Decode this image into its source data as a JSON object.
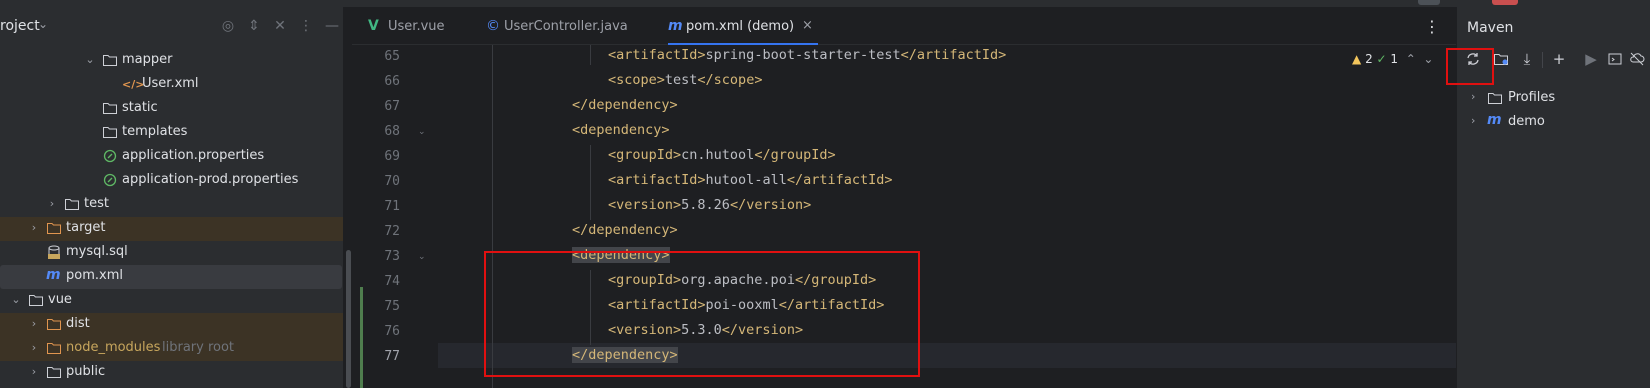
{
  "project_panel": {
    "title": "roject",
    "tree": [
      {
        "label": "mapper",
        "type": "folder",
        "expanded": true
      },
      {
        "label": "User.xml",
        "type": "xml"
      },
      {
        "label": "static",
        "type": "folder"
      },
      {
        "label": "templates",
        "type": "folder"
      },
      {
        "label": "application.properties",
        "type": "properties"
      },
      {
        "label": "application-prod.properties",
        "type": "properties"
      },
      {
        "label": "test",
        "type": "folder",
        "collapsed": true
      },
      {
        "label": "target",
        "type": "folder",
        "collapsed": true,
        "highlight": "excluded"
      },
      {
        "label": "mysql.sql",
        "type": "sql"
      },
      {
        "label": "pom.xml",
        "type": "maven",
        "selected": true
      },
      {
        "label": "vue",
        "type": "folder",
        "expanded": true
      },
      {
        "label": "dist",
        "type": "folder",
        "collapsed": true,
        "highlight": "excluded"
      },
      {
        "label": "node_modules",
        "hint": "library root",
        "type": "folder",
        "collapsed": true,
        "highlight": "excluded"
      },
      {
        "label": "public",
        "type": "folder",
        "collapsed": true
      }
    ]
  },
  "editor": {
    "tabs": [
      {
        "label": "User.vue",
        "icon": "vue-icon"
      },
      {
        "label": "UserController.java",
        "icon": "class-icon"
      },
      {
        "label": "pom.xml (demo)",
        "icon": "maven-icon",
        "active": true
      }
    ],
    "lines": [
      {
        "n": "65",
        "code": "<artifactId>spring-boot-starter-test</artifactId>"
      },
      {
        "n": "66",
        "code": "<scope>test</scope>"
      },
      {
        "n": "67",
        "code": "</dependency>"
      },
      {
        "n": "68",
        "code": "<dependency>"
      },
      {
        "n": "69",
        "code": "<groupId>cn.hutool</groupId>"
      },
      {
        "n": "70",
        "code": "<artifactId>hutool-all</artifactId>"
      },
      {
        "n": "71",
        "code": "<version>5.8.26</version>"
      },
      {
        "n": "72",
        "code": "</dependency>"
      },
      {
        "n": "73",
        "code": "<dependency>"
      },
      {
        "n": "74",
        "code": "<groupId>org.apache.poi</groupId>"
      },
      {
        "n": "75",
        "code": "<artifactId>poi-ooxml</artifactId>"
      },
      {
        "n": "76",
        "code": "<version>5.3.0</version>"
      },
      {
        "n": "77",
        "code": "</dependency>"
      }
    ],
    "inspection": {
      "warnings": "2",
      "ok": "1"
    }
  },
  "maven": {
    "title": "Maven",
    "toolbar": [
      "reload-icon",
      "add-folder-icon",
      "download-icon",
      "plus-icon",
      "run-icon",
      "terminal-icon",
      "offline-icon"
    ],
    "tree": [
      {
        "label": "Profiles",
        "type": "folder"
      },
      {
        "label": "demo",
        "type": "maven"
      }
    ]
  },
  "colors": {
    "tag": "#d5b778",
    "text": "#bcbec4",
    "highlight_box": "#e01010",
    "accent": "#3574f0"
  }
}
